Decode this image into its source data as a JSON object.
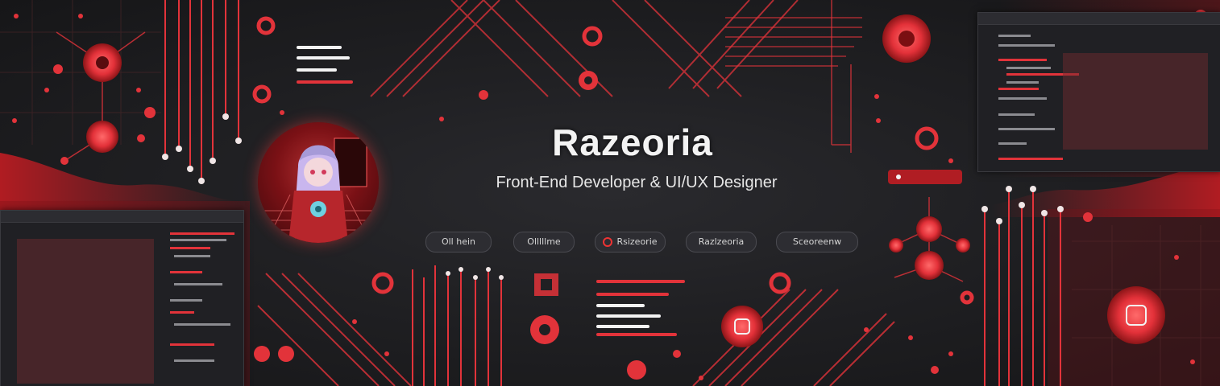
{
  "banner": {
    "name": "Razeoria",
    "tagline": "Front-End Developer & UI/UX Designer"
  },
  "pills": [
    {
      "label": "Oll hein",
      "icon": ""
    },
    {
      "label": "Olllllme",
      "icon": ""
    },
    {
      "label": "Rsizeorie",
      "icon": "ring-icon"
    },
    {
      "label": "Razlzeoria",
      "icon": ""
    },
    {
      "label": "Sceoreenw",
      "icon": ""
    }
  ],
  "colors": {
    "accent": "#e8333a",
    "accent_dark": "#9c1a1f",
    "background": "#1c1c1f",
    "panel": "#202024",
    "text": "#f3f3f3"
  }
}
